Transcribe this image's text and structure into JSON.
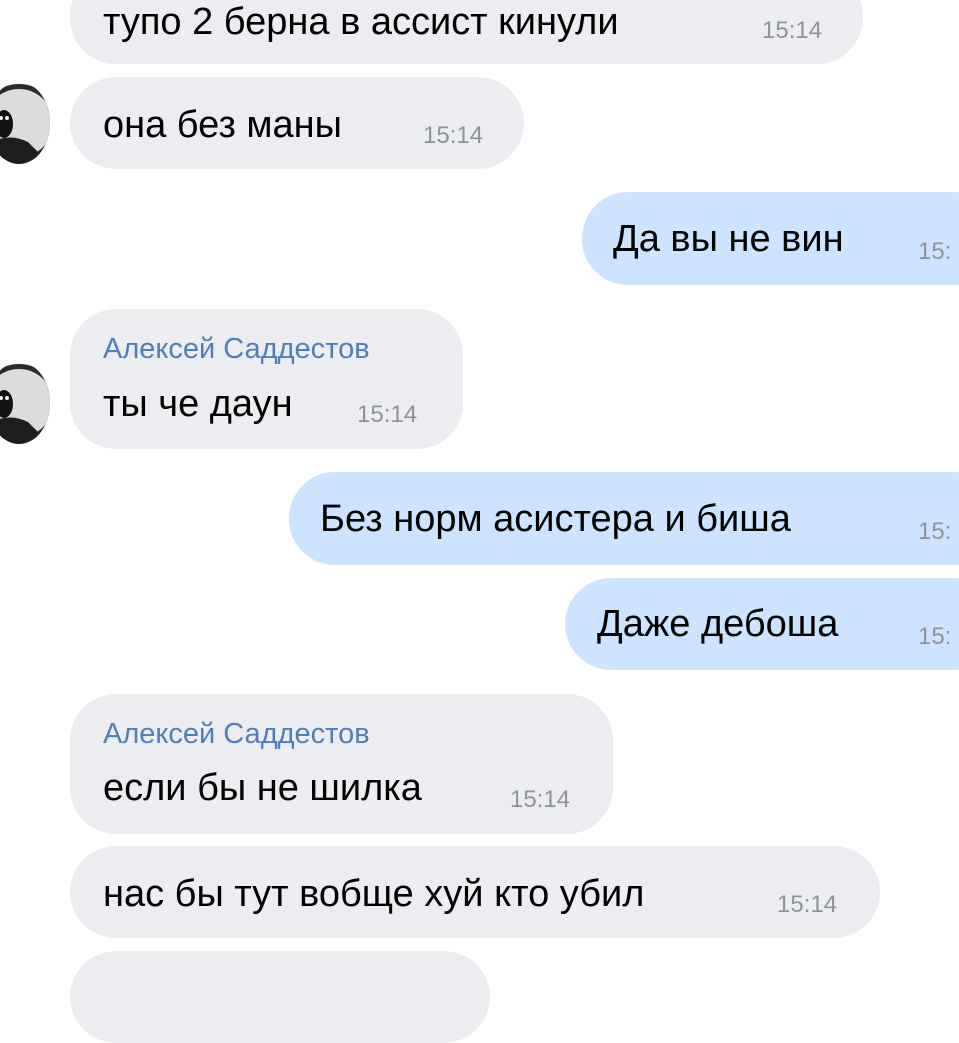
{
  "chat": {
    "messages": [
      {
        "direction": "in",
        "text": "тупо 2 берна в ассист кинули",
        "time": "15:14"
      },
      {
        "direction": "in",
        "text": "она без маны",
        "time": "15:14",
        "avatar": "owl-avatar"
      },
      {
        "direction": "out",
        "text": "Да вы не вин",
        "time": "15:"
      },
      {
        "direction": "in",
        "sender": "Алексей Саддестов",
        "text": "ты че даун",
        "time": "15:14",
        "avatar": "owl-avatar"
      },
      {
        "direction": "out",
        "text": "Без норм асистера и биша",
        "time": "15:"
      },
      {
        "direction": "out",
        "text": "Даже дебоша",
        "time": "15:"
      },
      {
        "direction": "in",
        "sender": "Алексей Саддестов",
        "text": "если бы не шилка",
        "time": "15:14"
      },
      {
        "direction": "in",
        "text": "нас бы тут вобще хуй кто убил",
        "time": "15:14"
      }
    ]
  },
  "colors": {
    "incoming_bubble": "#ecedf1",
    "outgoing_bubble": "#cce4ff",
    "sender_name": "#4f7fb8",
    "timestamp": "#8e939b"
  }
}
